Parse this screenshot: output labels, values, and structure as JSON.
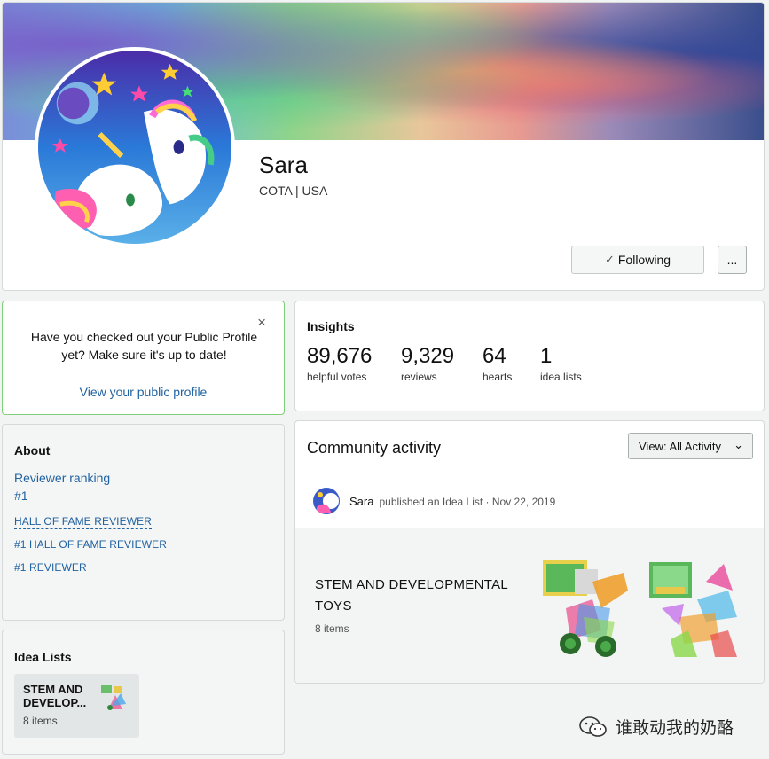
{
  "profile": {
    "name": "Sara",
    "subtitle": "COTA | USA",
    "following_label": "Following",
    "more_label": "..."
  },
  "notice": {
    "message": "Have you checked out your Public Profile yet? Make sure it's up to date!",
    "link": "View your public profile",
    "close": "×"
  },
  "about": {
    "title": "About",
    "ranking_label": "Reviewer ranking",
    "ranking_value": "#1",
    "badges": [
      "HALL OF FAME REVIEWER",
      "#1 HALL OF FAME REVIEWER",
      "#1 REVIEWER"
    ]
  },
  "idea_lists": {
    "title": "Idea Lists",
    "items": [
      {
        "name": "STEM AND DEVELOP...",
        "count": "8 items"
      }
    ]
  },
  "insights": {
    "title": "Insights",
    "stats": [
      {
        "value": "89,676",
        "label": "helpful votes"
      },
      {
        "value": "9,329",
        "label": "reviews"
      },
      {
        "value": "64",
        "label": "hearts"
      },
      {
        "value": "1",
        "label": "idea lists"
      }
    ]
  },
  "activity": {
    "title": "Community activity",
    "view_select": "View:  All Activity",
    "entry": {
      "user": "Sara",
      "action": "published an Idea List · Nov 22, 2019",
      "list_title": "STEM AND DEVELOPMENTAL TOYS",
      "list_count": "8 items"
    }
  },
  "watermark": "谁敢动我的奶酪",
  "colors": {
    "link": "#2162a1",
    "notice_border": "#7fd077",
    "card_border": "#d5d9d9"
  },
  "icons": [
    "check-icon",
    "close-icon",
    "chevron-down-icon",
    "wechat-icon"
  ]
}
